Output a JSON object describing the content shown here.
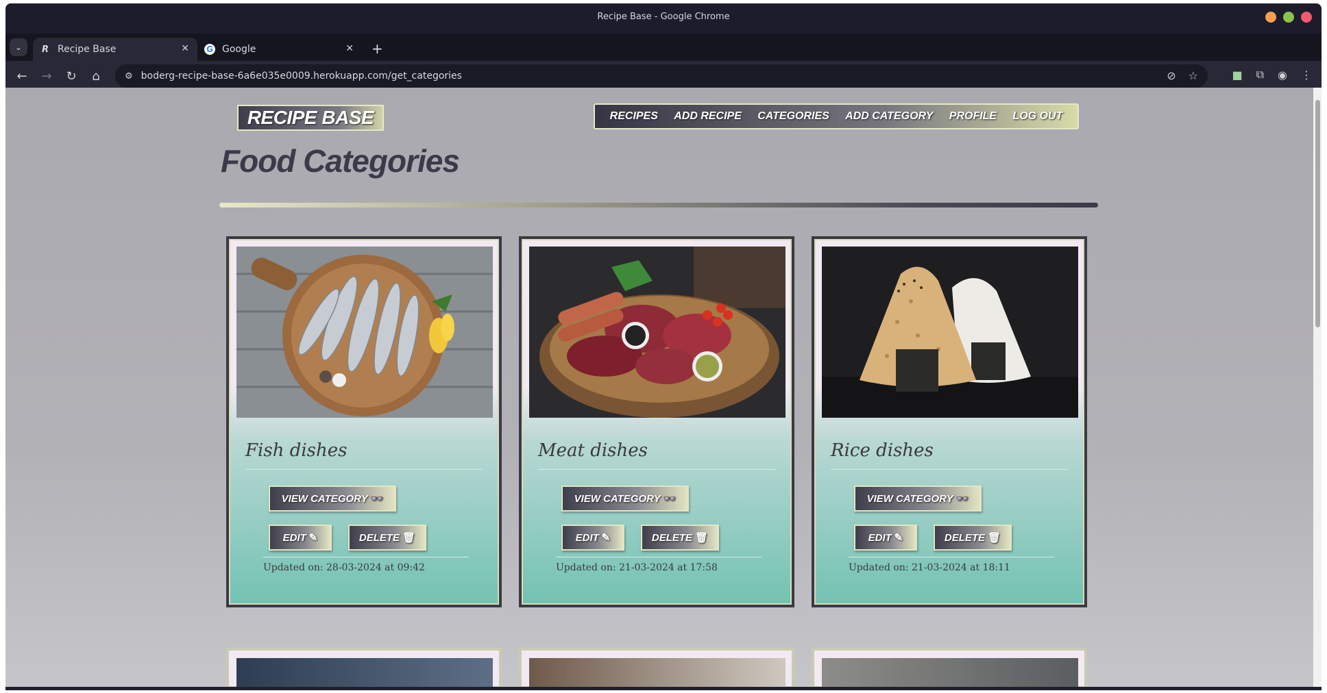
{
  "browser": {
    "window_title": "Recipe Base - Google Chrome",
    "tabs": [
      {
        "label": "Recipe Base",
        "favicon": "R",
        "active": true
      },
      {
        "label": "Google",
        "favicon": "G",
        "active": false
      }
    ],
    "url": "boderg-recipe-base-6a6e035e0009.herokuapp.com/get_categories"
  },
  "site": {
    "logo": "RECIPE BASE",
    "nav": [
      "RECIPES",
      "ADD RECIPE",
      "CATEGORIES",
      "ADD CATEGORY",
      "PROFILE",
      "LOG OUT"
    ]
  },
  "main": {
    "title": "Food Categories",
    "categories": [
      {
        "name": "Fish dishes",
        "view_label": "VIEW CATEGORY",
        "edit_label": "EDIT",
        "delete_label": "DELETE",
        "updated": "Updated on: 28-03-2024 at 09:42"
      },
      {
        "name": "Meat dishes",
        "view_label": "VIEW CATEGORY",
        "edit_label": "EDIT",
        "delete_label": "DELETE",
        "updated": "Updated on: 21-03-2024 at 17:58"
      },
      {
        "name": "Rice dishes",
        "view_label": "VIEW CATEGORY",
        "edit_label": "EDIT",
        "delete_label": "DELETE",
        "updated": "Updated on: 21-03-2024 at 18:11"
      }
    ]
  },
  "colors": {
    "page_bg": "#aaa9b0",
    "card_teal": "#72c2b2",
    "title": "#3b3a48",
    "accent_cream": "#e4e6c4"
  }
}
